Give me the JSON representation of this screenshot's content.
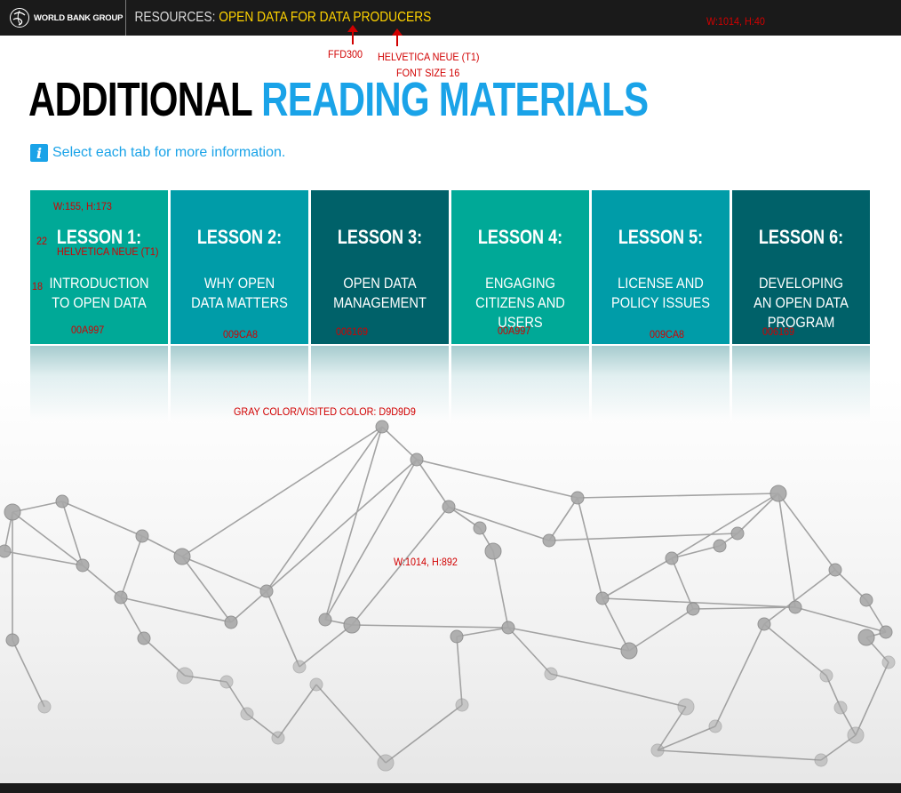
{
  "header": {
    "logo_text": "WORLD BANK GROUP",
    "breadcrumb_prefix": "RESOURCES:",
    "breadcrumb_title": "OPEN DATA FOR DATA PRODUCERS",
    "bg_color": "#1a1a1a",
    "title_color": "#FFD300"
  },
  "page": {
    "heading_dark": "ADDITIONAL",
    "heading_accent": "READING MATERIALS",
    "heading_accent_color": "#1aa3e8",
    "instruction": "Select each tab for more information.",
    "instruction_icon": "info-icon"
  },
  "tabs": [
    {
      "title": "LESSON 1:",
      "desc": "INTRODUCTION TO OPEN DATA",
      "color": "#00A997"
    },
    {
      "title": "LESSON 2:",
      "desc": "WHY OPEN DATA MATTERS",
      "color": "#009CA8"
    },
    {
      "title": "LESSON 3:",
      "desc": "OPEN DATA MANAGEMENT",
      "color": "#006169"
    },
    {
      "title": "LESSON 4:",
      "desc": "ENGAGING CITIZENS AND USERS",
      "color": "#00A997"
    },
    {
      "title": "LESSON 5:",
      "desc": "LICENSE AND POLICY ISSUES",
      "color": "#009CA8"
    },
    {
      "title": "LESSON 6:",
      "desc": "DEVELOPING AN OPEN DATA PROGRAM",
      "color": "#006169"
    }
  ],
  "annotations": {
    "header_color_code": "FFD300",
    "header_font": "HELVETICA NEUE (T1)",
    "header_font_size": "FONT SIZE 16",
    "header_size": "W:1014,  H:40",
    "tab_size": "W:155,  H:173",
    "tab_title_size": "22",
    "tab_font": "HELVETICA NEUE (T1)",
    "tab_desc_size": "18",
    "tab_colors": [
      "00A997",
      "009CA8",
      "006169",
      "00A997",
      "009CA8",
      "006169"
    ],
    "visited_color": "GRAY COLOR/VISITED COLOR: D9D9D9",
    "page_size": "W:1014,  H:892"
  }
}
